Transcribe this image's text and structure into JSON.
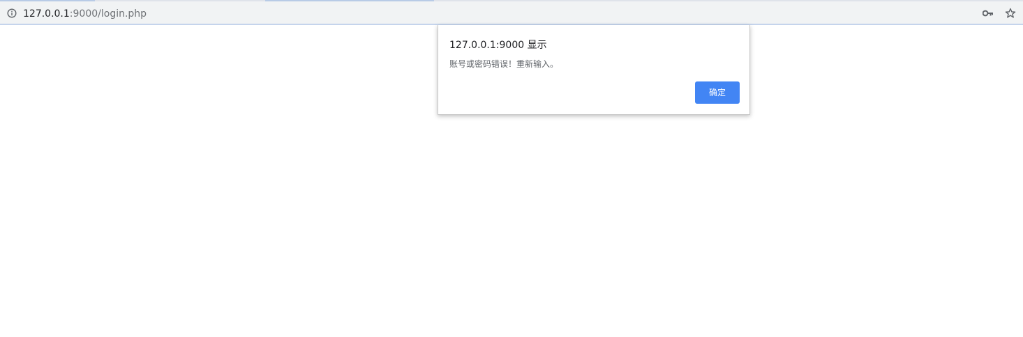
{
  "browser": {
    "address_bar": {
      "host": "127.0.0.1",
      "rest": ":9000/login.php"
    },
    "icons": {
      "site_info": "info-icon",
      "password": "key-icon",
      "bookmark": "star-icon"
    }
  },
  "dialog": {
    "title": "127.0.0.1:9000 显示",
    "message": "账号或密码错误！重新输入。",
    "ok_label": "确定",
    "ok_color": "#4285f4"
  }
}
